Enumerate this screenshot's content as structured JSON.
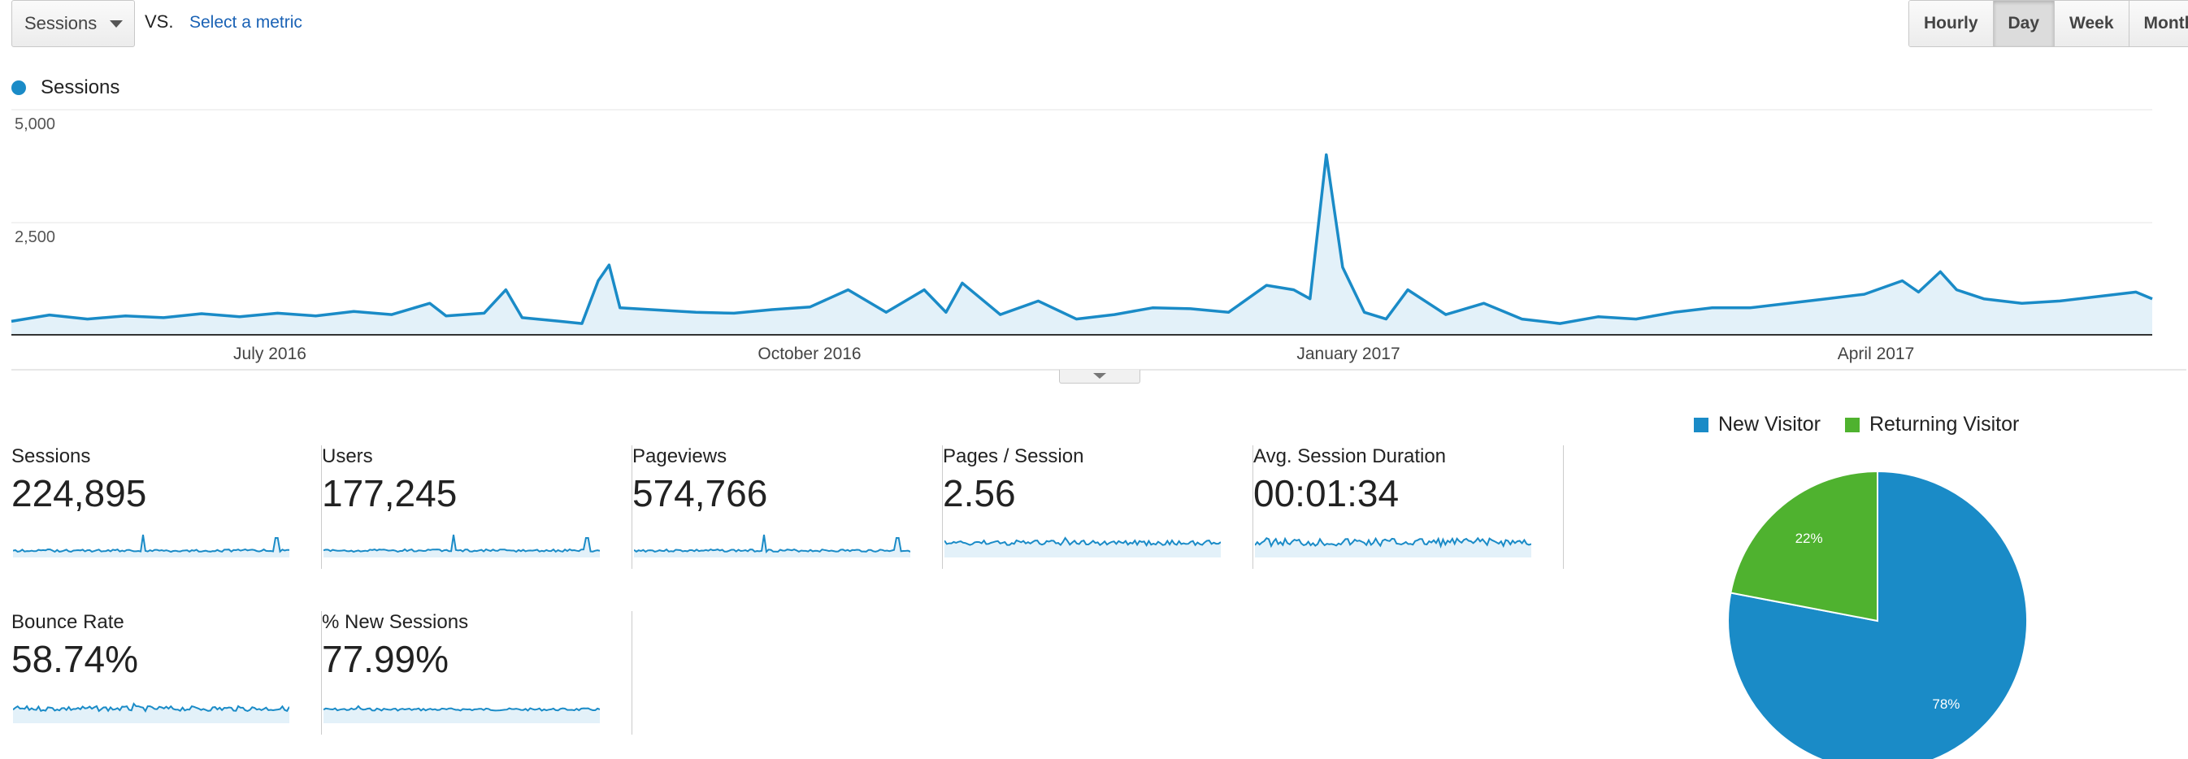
{
  "toolbar": {
    "metric_select": "Sessions",
    "vs_label": "VS.",
    "select_metric_link": "Select a metric",
    "periods": [
      "Hourly",
      "Day",
      "Week",
      "Month"
    ],
    "active_period": "Day"
  },
  "colors": {
    "sessions": "#1a8bc7",
    "new_visitor": "#1a8bc7",
    "returning_visitor": "#4fb22f"
  },
  "chart_data": [
    {
      "type": "line",
      "series": [
        {
          "name": "Sessions"
        }
      ],
      "ylim": [
        0,
        5000
      ],
      "y_ticks": [
        "5,000",
        "2,500"
      ],
      "x_ticks": [
        "July 2016",
        "October 2016",
        "January 2017",
        "April 2017"
      ],
      "x_range": [
        "2016-05-17",
        "2017-06-15"
      ],
      "points": [
        [
          "2016-05-17",
          300
        ],
        [
          "2016-05-24",
          440
        ],
        [
          "2016-05-31",
          350
        ],
        [
          "2016-06-07",
          420
        ],
        [
          "2016-06-14",
          380
        ],
        [
          "2016-06-21",
          470
        ],
        [
          "2016-06-28",
          400
        ],
        [
          "2016-07-05",
          480
        ],
        [
          "2016-07-12",
          420
        ],
        [
          "2016-07-19",
          520
        ],
        [
          "2016-07-26",
          450
        ],
        [
          "2016-08-02",
          700
        ],
        [
          "2016-08-05",
          420
        ],
        [
          "2016-08-12",
          480
        ],
        [
          "2016-08-16",
          1000
        ],
        [
          "2016-08-19",
          380
        ],
        [
          "2016-08-26",
          300
        ],
        [
          "2016-08-30",
          250
        ],
        [
          "2016-09-02",
          1200
        ],
        [
          "2016-09-04",
          1550
        ],
        [
          "2016-09-06",
          600
        ],
        [
          "2016-09-13",
          550
        ],
        [
          "2016-09-20",
          500
        ],
        [
          "2016-09-27",
          480
        ],
        [
          "2016-10-04",
          560
        ],
        [
          "2016-10-11",
          620
        ],
        [
          "2016-10-18",
          1000
        ],
        [
          "2016-10-25",
          500
        ],
        [
          "2016-11-01",
          1000
        ],
        [
          "2016-11-05",
          500
        ],
        [
          "2016-11-08",
          1150
        ],
        [
          "2016-11-15",
          450
        ],
        [
          "2016-11-22",
          750
        ],
        [
          "2016-11-29",
          350
        ],
        [
          "2016-12-06",
          450
        ],
        [
          "2016-12-13",
          600
        ],
        [
          "2016-12-20",
          580
        ],
        [
          "2016-12-27",
          500
        ],
        [
          "2017-01-03",
          1100
        ],
        [
          "2017-01-08",
          1000
        ],
        [
          "2017-01-11",
          800
        ],
        [
          "2017-01-14",
          4000
        ],
        [
          "2017-01-17",
          1500
        ],
        [
          "2017-01-21",
          500
        ],
        [
          "2017-01-25",
          350
        ],
        [
          "2017-01-29",
          1000
        ],
        [
          "2017-02-05",
          450
        ],
        [
          "2017-02-12",
          700
        ],
        [
          "2017-02-19",
          350
        ],
        [
          "2017-02-26",
          250
        ],
        [
          "2017-03-05",
          400
        ],
        [
          "2017-03-12",
          350
        ],
        [
          "2017-03-19",
          500
        ],
        [
          "2017-03-26",
          600
        ],
        [
          "2017-04-02",
          600
        ],
        [
          "2017-04-09",
          700
        ],
        [
          "2017-04-16",
          800
        ],
        [
          "2017-04-23",
          900
        ],
        [
          "2017-04-30",
          1200
        ],
        [
          "2017-05-03",
          950
        ],
        [
          "2017-05-07",
          1400
        ],
        [
          "2017-05-10",
          1000
        ],
        [
          "2017-05-15",
          800
        ],
        [
          "2017-05-22",
          700
        ],
        [
          "2017-05-29",
          750
        ],
        [
          "2017-06-05",
          850
        ],
        [
          "2017-06-12",
          950
        ],
        [
          "2017-06-15",
          800
        ]
      ]
    },
    {
      "type": "pie",
      "series": [
        {
          "name": "New Visitor",
          "value": 78,
          "label": "78%"
        },
        {
          "name": "Returning Visitor",
          "value": 22,
          "label": "22%"
        }
      ]
    }
  ],
  "tiles": [
    {
      "label": "Sessions",
      "value": "224,895"
    },
    {
      "label": "Users",
      "value": "177,245"
    },
    {
      "label": "Pageviews",
      "value": "574,766"
    },
    {
      "label": "Pages / Session",
      "value": "2.56"
    },
    {
      "label": "Avg. Session Duration",
      "value": "00:01:34"
    },
    {
      "label": "Bounce Rate",
      "value": "58.74%"
    },
    {
      "label": "% New Sessions",
      "value": "77.99%"
    }
  ]
}
